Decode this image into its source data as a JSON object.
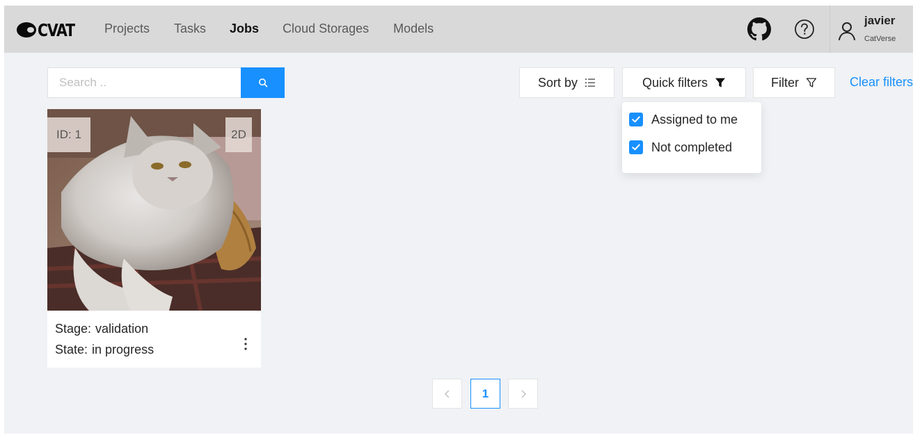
{
  "header": {
    "logo_text": "CVAT",
    "nav": [
      "Projects",
      "Tasks",
      "Jobs",
      "Cloud Storages",
      "Models"
    ],
    "active_nav": "Jobs",
    "user": {
      "name": "javier",
      "org": "CatVerse"
    },
    "icons": [
      "github-icon",
      "help-icon",
      "user-icon"
    ]
  },
  "search": {
    "placeholder": "Search .."
  },
  "toolbar": {
    "sort_label": "Sort by",
    "quick_filters_label": "Quick filters",
    "filter_label": "Filter",
    "clear_filters_label": "Clear filters"
  },
  "quick_filters": {
    "items": [
      {
        "label": "Assigned to me",
        "checked": true
      },
      {
        "label": "Not completed",
        "checked": true
      }
    ]
  },
  "jobs": [
    {
      "id_label": "ID: 1",
      "dimension": "2D",
      "stage_key": "Stage:",
      "stage_value": "validation",
      "state_key": "State:",
      "state_value": "in progress"
    }
  ],
  "pagination": {
    "current_page": "1"
  },
  "colors": {
    "accent": "#1890ff",
    "header_bg": "#d9d9d9",
    "page_bg": "#f0f2f5"
  }
}
